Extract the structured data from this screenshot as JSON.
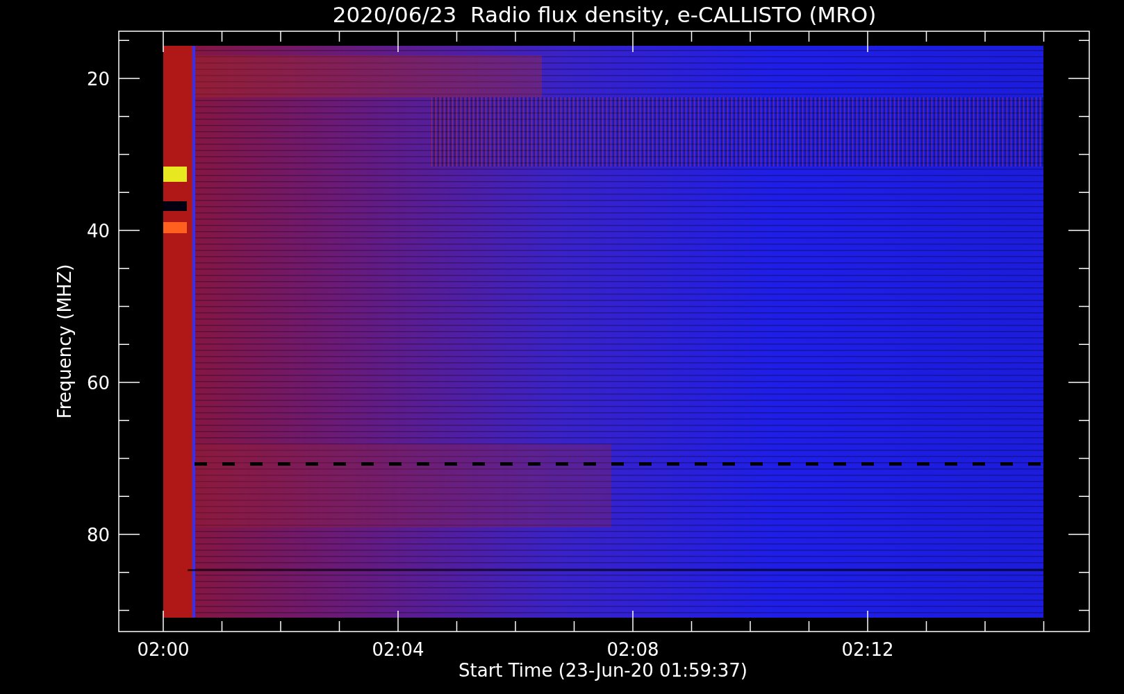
{
  "title": "2020/06/23  Radio flux density, e-CALLISTO (MRO)",
  "y_axis": {
    "label": "Frequency (MHZ)",
    "ticks": [
      "20",
      "40",
      "60",
      "80"
    ]
  },
  "x_axis": {
    "label": "Start Time (23-Jun-20 01:59:37)",
    "ticks": [
      "02:00",
      "02:04",
      "02:08",
      "02:12"
    ]
  }
}
